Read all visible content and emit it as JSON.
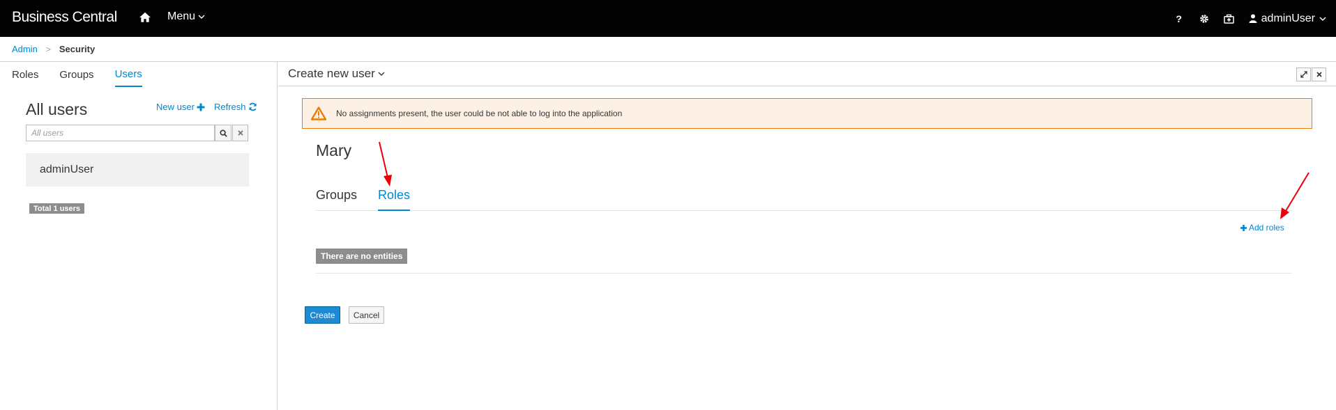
{
  "navbar": {
    "brand": "Business Central",
    "menu_label": "Menu",
    "help_glyph": "?",
    "user_label": "adminUser",
    "icons": [
      "home-icon",
      "chevron-down-icon",
      "help-icon",
      "gear-icon",
      "briefcase-icon",
      "user-icon"
    ]
  },
  "breadcrumb": {
    "items": [
      "Admin",
      "Security"
    ],
    "separator": ">"
  },
  "left_panel": {
    "tabs": [
      {
        "label": "Roles",
        "active": false
      },
      {
        "label": "Groups",
        "active": false
      },
      {
        "label": "Users",
        "active": true
      }
    ],
    "title": "All users",
    "new_user_label": "New user",
    "refresh_label": "Refresh",
    "search_placeholder": "All users",
    "users": [
      "adminUser"
    ],
    "total_label": "Total 1 users"
  },
  "right_panel": {
    "title": "Create new user",
    "alert": {
      "text": "No assignments present, the user could be not able to log into the application",
      "type": "warning",
      "color": "#ec7a08"
    },
    "user_name": "Mary",
    "tabs": [
      {
        "label": "Groups",
        "active": false
      },
      {
        "label": "Roles",
        "active": true
      }
    ],
    "add_roles_label": "Add roles",
    "empty_label": "There are no entities",
    "create_label": "Create",
    "cancel_label": "Cancel"
  },
  "colors": {
    "accent": "#0088ce",
    "navbar_bg": "#030303",
    "primary_button": "#1e8ad3",
    "annotation_arrow": "#e8000b"
  }
}
